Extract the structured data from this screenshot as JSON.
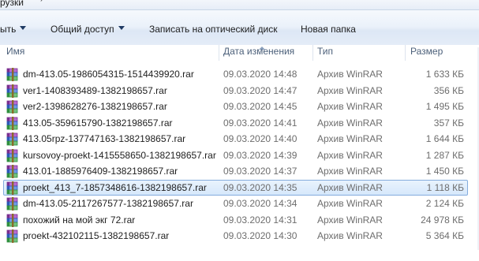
{
  "address": {
    "crumb": "рузки"
  },
  "toolbar": {
    "organize_label": "ыть",
    "share_label": "Общий доступ",
    "burn_label": "Записать на оптический диск",
    "new_folder_label": "Новая папка"
  },
  "columns": {
    "name": "Имя",
    "date": "Дата изменения",
    "type": "Тип",
    "size": "Размер"
  },
  "files": [
    {
      "name": "dm-413.05-1986054315-1514439920.rar",
      "date": "09.03.2020 14:48",
      "type": "Архив WinRAR",
      "size": "1 633 КБ"
    },
    {
      "name": "ver1-1408393489-1382198657.rar",
      "date": "09.03.2020 14:47",
      "type": "Архив WinRAR",
      "size": "356 КБ"
    },
    {
      "name": "ver2-1398628276-1382198657.rar",
      "date": "09.03.2020 14:45",
      "type": "Архив WinRAR",
      "size": "1 495 КБ"
    },
    {
      "name": "413.05-359615790-1382198657.rar",
      "date": "09.03.2020 14:41",
      "type": "Архив WinRAR",
      "size": "357 КБ"
    },
    {
      "name": "413.05rpz-137747163-1382198657.rar",
      "date": "09.03.2020 14:40",
      "type": "Архив WinRAR",
      "size": "1 644 КБ"
    },
    {
      "name": "kursovoy-proekt-1415558650-1382198657.rar",
      "date": "09.03.2020 14:39",
      "type": "Архив WinRAR",
      "size": "1 287 КБ"
    },
    {
      "name": "413.01-1885976409-1382198657.rar",
      "date": "09.03.2020 14:37",
      "type": "Архив WinRAR",
      "size": "1 450 КБ"
    },
    {
      "name": "proekt_413_7-1857348616-1382198657.rar",
      "date": "09.03.2020 14:35",
      "type": "Архив WinRAR",
      "size": "1 118 КБ",
      "selected": true
    },
    {
      "name": "dm-413.05-2117267577-1382198657.rar",
      "date": "09.03.2020 14:34",
      "type": "Архив WinRAR",
      "size": "2 124 КБ"
    },
    {
      "name": "похожий на мой экг 72.rar",
      "date": "09.03.2020 14:31",
      "type": "Архив WinRAR",
      "size": "24 978 КБ"
    },
    {
      "name": "proekt-432102115-1382198657.rar",
      "date": "09.03.2020 14:30",
      "type": "Архив WinRAR",
      "size": "5 364 КБ"
    },
    {
      "name": "",
      "date": "",
      "type": "",
      "size": ""
    }
  ],
  "colors": {
    "selection": "#cce4fb",
    "header_text": "#4c607a",
    "muted_text": "#6d6d6d"
  },
  "icons": {
    "file": "winrar-archive-icon"
  }
}
